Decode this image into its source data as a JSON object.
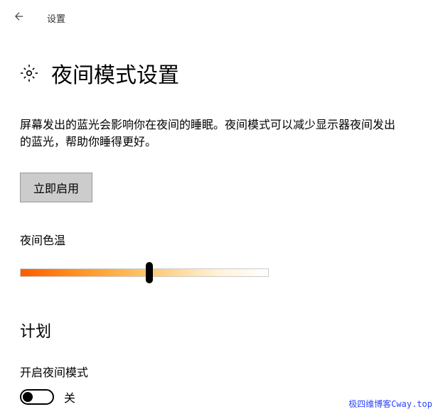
{
  "header": {
    "title": "设置"
  },
  "page": {
    "title": "夜间模式设置",
    "description": "屏幕发出的蓝光会影响你在夜间的睡眠。夜间模式可以减少显示器夜间发出的蓝光，帮助你睡得更好。"
  },
  "actions": {
    "enable_now": "立即启用"
  },
  "slider": {
    "label": "夜间色温"
  },
  "schedule": {
    "title": "计划",
    "toggle_label": "开启夜间模式",
    "toggle_state": "关"
  },
  "watermark": "极四维博客Cway.top"
}
